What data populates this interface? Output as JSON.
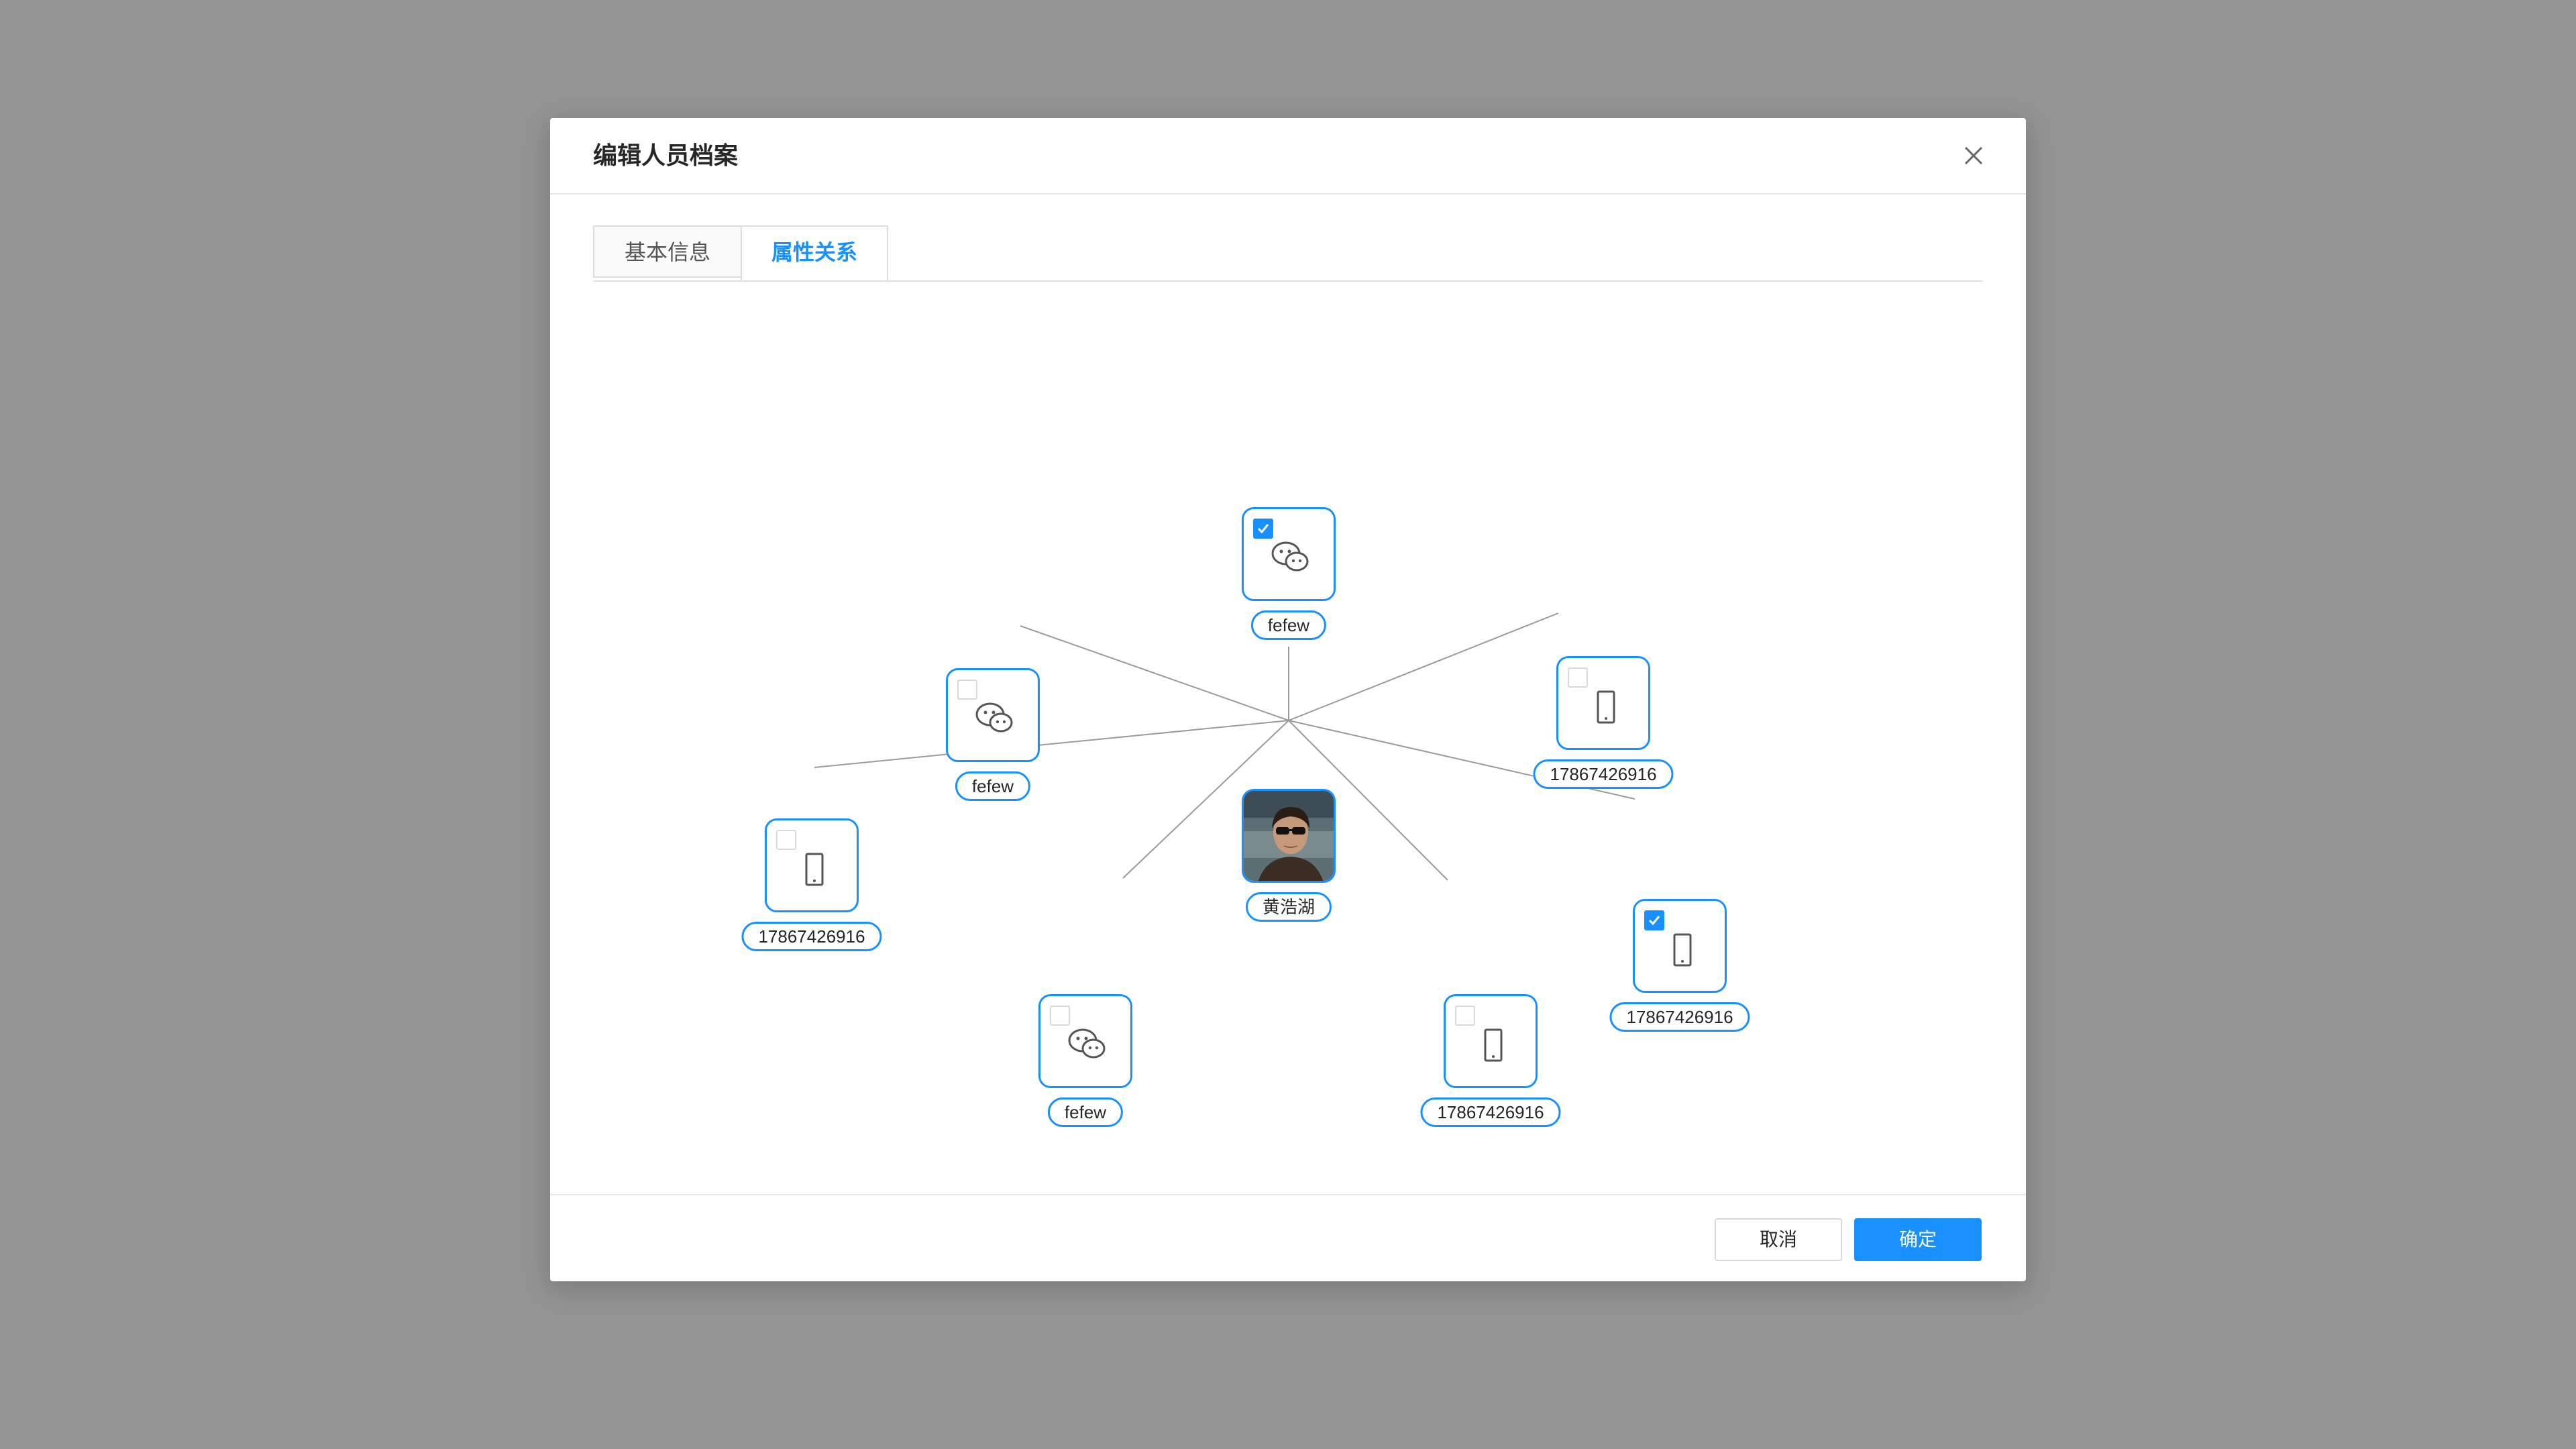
{
  "dialog": {
    "title": "编辑人员档案",
    "close_icon": "close-icon"
  },
  "tabs": [
    {
      "label": "基本信息",
      "active": false
    },
    {
      "label": "属性关系",
      "active": true
    }
  ],
  "graph": {
    "center": {
      "label": "黄浩湖",
      "type": "avatar"
    },
    "nodes": [
      {
        "label": "fefew",
        "icon": "wechat-icon",
        "checked": true
      },
      {
        "label": "fefew",
        "icon": "wechat-icon",
        "checked": false
      },
      {
        "label": "17867426916",
        "icon": "phone-icon",
        "checked": false
      },
      {
        "label": "17867426916",
        "icon": "phone-icon",
        "checked": false
      },
      {
        "label": "17867426916",
        "icon": "phone-icon",
        "checked": true
      },
      {
        "label": "fefew",
        "icon": "wechat-icon",
        "checked": false
      },
      {
        "label": "17867426916",
        "icon": "phone-icon",
        "checked": false
      }
    ]
  },
  "footer": {
    "cancel_label": "取消",
    "ok_label": "确定"
  },
  "colors": {
    "accent": "#1890ff",
    "overlay": "#939393"
  }
}
